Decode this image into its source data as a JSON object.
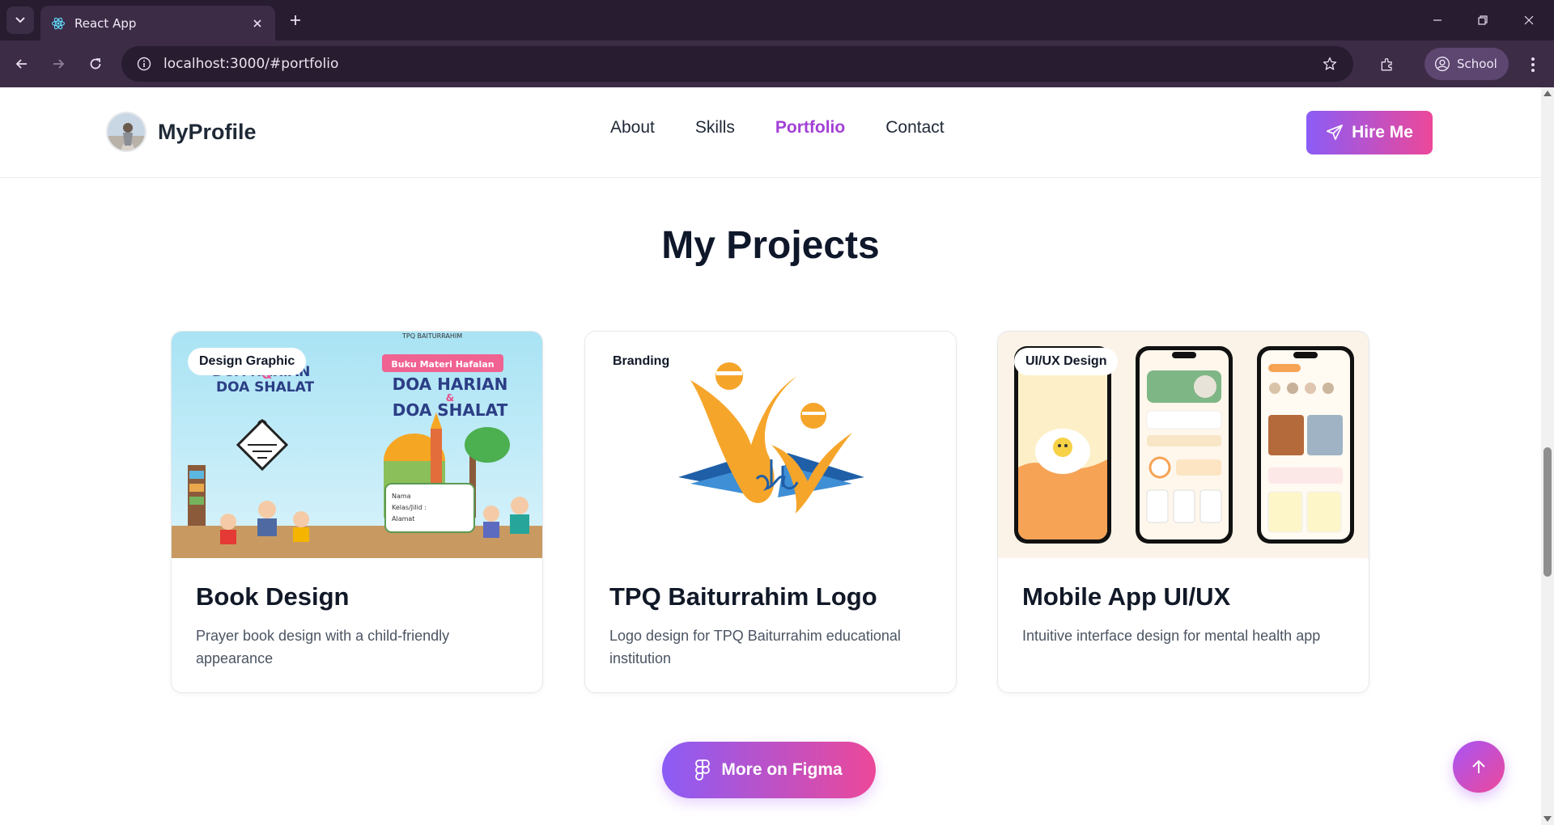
{
  "browser": {
    "tab_title": "React App",
    "url": "localhost:3000/#portfolio",
    "profile_label": "School"
  },
  "site": {
    "brand_name": "MyProfile",
    "nav": [
      {
        "label": "About",
        "active": false
      },
      {
        "label": "Skills",
        "active": false
      },
      {
        "label": "Portfolio",
        "active": true
      },
      {
        "label": "Contact",
        "active": false
      }
    ],
    "hire_label": "Hire Me",
    "accent_gradient": [
      "#8b5cf6",
      "#ec4899"
    ],
    "active_color": "#a33fd6"
  },
  "projects": {
    "title": "My Projects",
    "cards": [
      {
        "badge": "Design Graphic",
        "title": "Book Design",
        "desc": "Prayer book design with a child-friendly appearance",
        "cover": {
          "left_title_1": "DOA HARIAN",
          "left_title_amp": "&",
          "left_title_2": "DOA SHALAT",
          "right_ribbon": "Buku Materi Hafalan",
          "right_title_1": "DOA HARIAN",
          "right_title_amp": "&",
          "right_title_2": "DOA SHALAT",
          "right_header": "TPQ BAITURRAHIM",
          "field_1": "Nama",
          "field_2": "Kelas/Jilid :",
          "field_3": "Alamat"
        }
      },
      {
        "badge": "Branding",
        "title": "TPQ Baiturrahim Logo",
        "desc": "Logo design for TPQ Baiturrahim educational institution"
      },
      {
        "badge": "UI/UX Design",
        "title": "Mobile App UI/UX",
        "desc": "Intuitive interface design for mental health app"
      }
    ],
    "figma_label": "More on Figma"
  }
}
